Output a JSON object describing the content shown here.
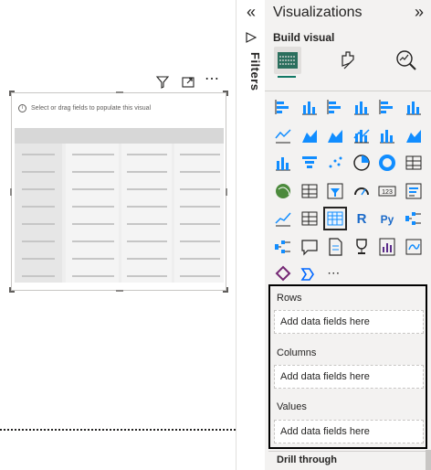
{
  "canvas": {
    "visual_hint": "Select or drag fields to populate this visual",
    "header_more": "⋯",
    "info_glyph": "i"
  },
  "filters": {
    "collapse_glyph": "«",
    "label": "Filters"
  },
  "visualizations": {
    "title": "Visualizations",
    "collapse_glyph": "»",
    "build_visual_label": "Build visual",
    "more_glyph": "⋯",
    "r_label": "R",
    "py_label": "Py",
    "card_label": "123"
  },
  "wells": {
    "rows_title": "Rows",
    "rows_placeholder": "Add data fields here",
    "columns_title": "Columns",
    "columns_placeholder": "Add data fields here",
    "values_title": "Values",
    "values_placeholder": "Add data fields here"
  },
  "drill_through_label": "Drill through",
  "colors": {
    "accent": "#117865",
    "pane_bg": "#f3f2f1",
    "icon_blue": "#118dff",
    "icon_dark": "#252423"
  }
}
